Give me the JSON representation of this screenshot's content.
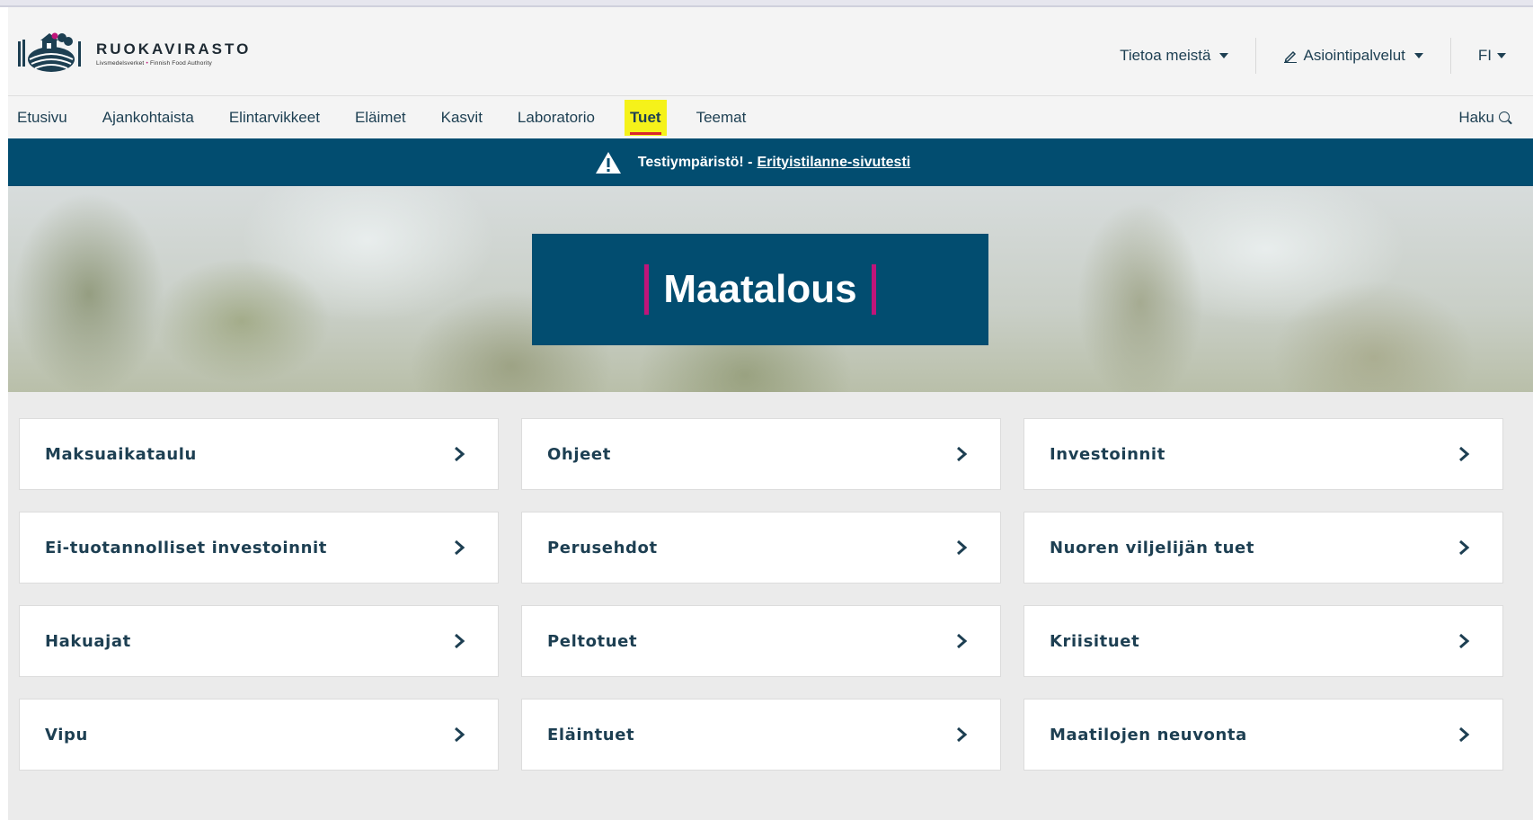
{
  "header": {
    "logo_name": "RUOKAVIRASTO",
    "logo_sub_left": "Livsmedelsverket",
    "logo_sub_sep": "•",
    "logo_sub_right": "Finnish Food Authority",
    "top_links": [
      {
        "label": "Tietoa meistä",
        "icon": "chevron-down-icon"
      },
      {
        "label": "Asiointipalvelut",
        "icon": "pen-icon"
      },
      {
        "label": "FI",
        "icon": "chevron-down-icon"
      }
    ]
  },
  "nav": {
    "items": [
      {
        "label": "Etusivu"
      },
      {
        "label": "Ajankohtaista"
      },
      {
        "label": "Elintarvikkeet"
      },
      {
        "label": "Eläimet"
      },
      {
        "label": "Kasvit"
      },
      {
        "label": "Laboratorio"
      },
      {
        "label": "Tuet",
        "active": true
      },
      {
        "label": "Teemat"
      }
    ],
    "search_label": "Haku"
  },
  "banner": {
    "text": "Testiympäristö! -",
    "link": "Erityistilanne-sivutesti"
  },
  "hero": {
    "title": "Maatalous"
  },
  "cards": [
    {
      "label": "Maksuaikataulu"
    },
    {
      "label": "Ohjeet"
    },
    {
      "label": "Investoinnit"
    },
    {
      "label": "Ei-tuotannolliset investoinnit"
    },
    {
      "label": "Perusehdot"
    },
    {
      "label": "Nuoren viljelijän tuet"
    },
    {
      "label": "Hakuajat"
    },
    {
      "label": "Peltotuet"
    },
    {
      "label": "Kriisituet"
    },
    {
      "label": "Vipu"
    },
    {
      "label": "Eläintuet"
    },
    {
      "label": "Maatilojen neuvonta"
    }
  ],
  "colors": {
    "brand_blue": "#024d70",
    "accent_magenta": "#c0157a",
    "highlight_yellow": "#f5f21a",
    "active_underline": "#d9252b"
  }
}
